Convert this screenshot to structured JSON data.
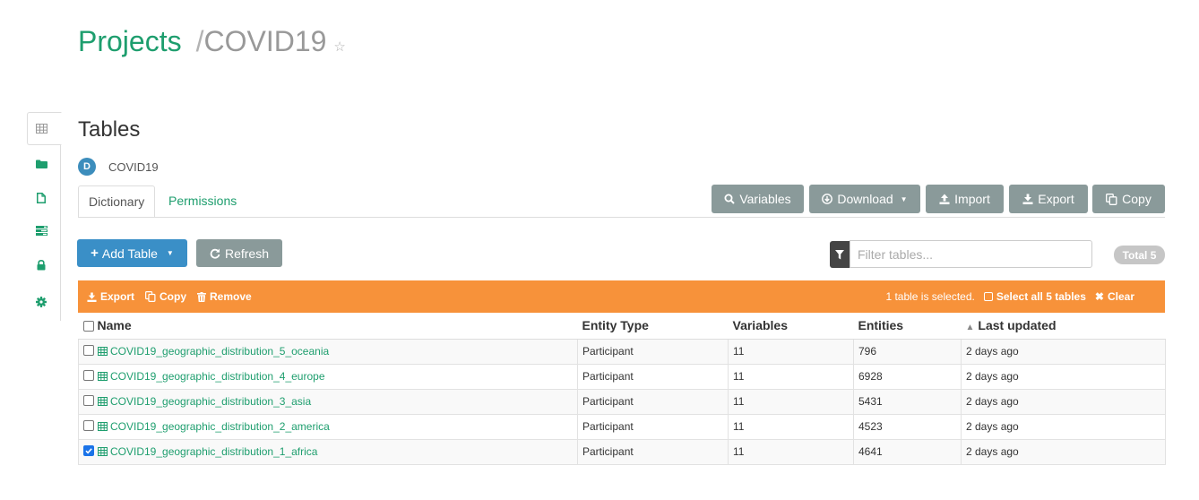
{
  "breadcrumb": {
    "projects_label": "Projects",
    "separator": "/",
    "project_name": "COVID19",
    "star_icon": "star-outline-icon"
  },
  "sidenav": {
    "items": [
      {
        "icon": "table-icon",
        "active": true
      },
      {
        "icon": "folder-icon"
      },
      {
        "icon": "file-icon"
      },
      {
        "icon": "list-icon"
      },
      {
        "icon": "lock-icon"
      },
      {
        "icon": "gear-icon"
      }
    ]
  },
  "page": {
    "title": "Tables",
    "datasource_badge": "D",
    "datasource_name": "COVID19"
  },
  "tabs": [
    {
      "label": "Dictionary",
      "active": true
    },
    {
      "label": "Permissions",
      "active": false
    }
  ],
  "toolbar": {
    "variables_label": "Variables",
    "download_label": "Download",
    "import_label": "Import",
    "export_label": "Export",
    "copy_label": "Copy"
  },
  "actions": {
    "add_table_label": "Add Table",
    "refresh_label": "Refresh"
  },
  "filter": {
    "placeholder": "Filter tables...",
    "total_label": "Total 5"
  },
  "selection_bar": {
    "export_label": "Export",
    "copy_label": "Copy",
    "remove_label": "Remove",
    "selected_text": "1 table is selected.",
    "select_all_label": "Select all 5 tables",
    "clear_label": "Clear"
  },
  "table": {
    "columns": [
      "Name",
      "Entity Type",
      "Variables",
      "Entities",
      "Last updated"
    ],
    "rows": [
      {
        "name": "COVID19_geographic_distribution_5_oceania",
        "entity_type": "Participant",
        "variables": "11",
        "entities": "796",
        "updated": "2 days ago",
        "checked": false
      },
      {
        "name": "COVID19_geographic_distribution_4_europe",
        "entity_type": "Participant",
        "variables": "11",
        "entities": "6928",
        "updated": "2 days ago",
        "checked": false
      },
      {
        "name": "COVID19_geographic_distribution_3_asia",
        "entity_type": "Participant",
        "variables": "11",
        "entities": "5431",
        "updated": "2 days ago",
        "checked": false
      },
      {
        "name": "COVID19_geographic_distribution_2_america",
        "entity_type": "Participant",
        "variables": "11",
        "entities": "4523",
        "updated": "2 days ago",
        "checked": false
      },
      {
        "name": "COVID19_geographic_distribution_1_africa",
        "entity_type": "Participant",
        "variables": "11",
        "entities": "4641",
        "updated": "2 days ago",
        "checked": true
      }
    ]
  },
  "colors": {
    "brand_green": "#1e9e6e",
    "primary_blue": "#3a8fc7",
    "selection_orange": "#f7923a",
    "gray_button": "#8a9a9a"
  }
}
